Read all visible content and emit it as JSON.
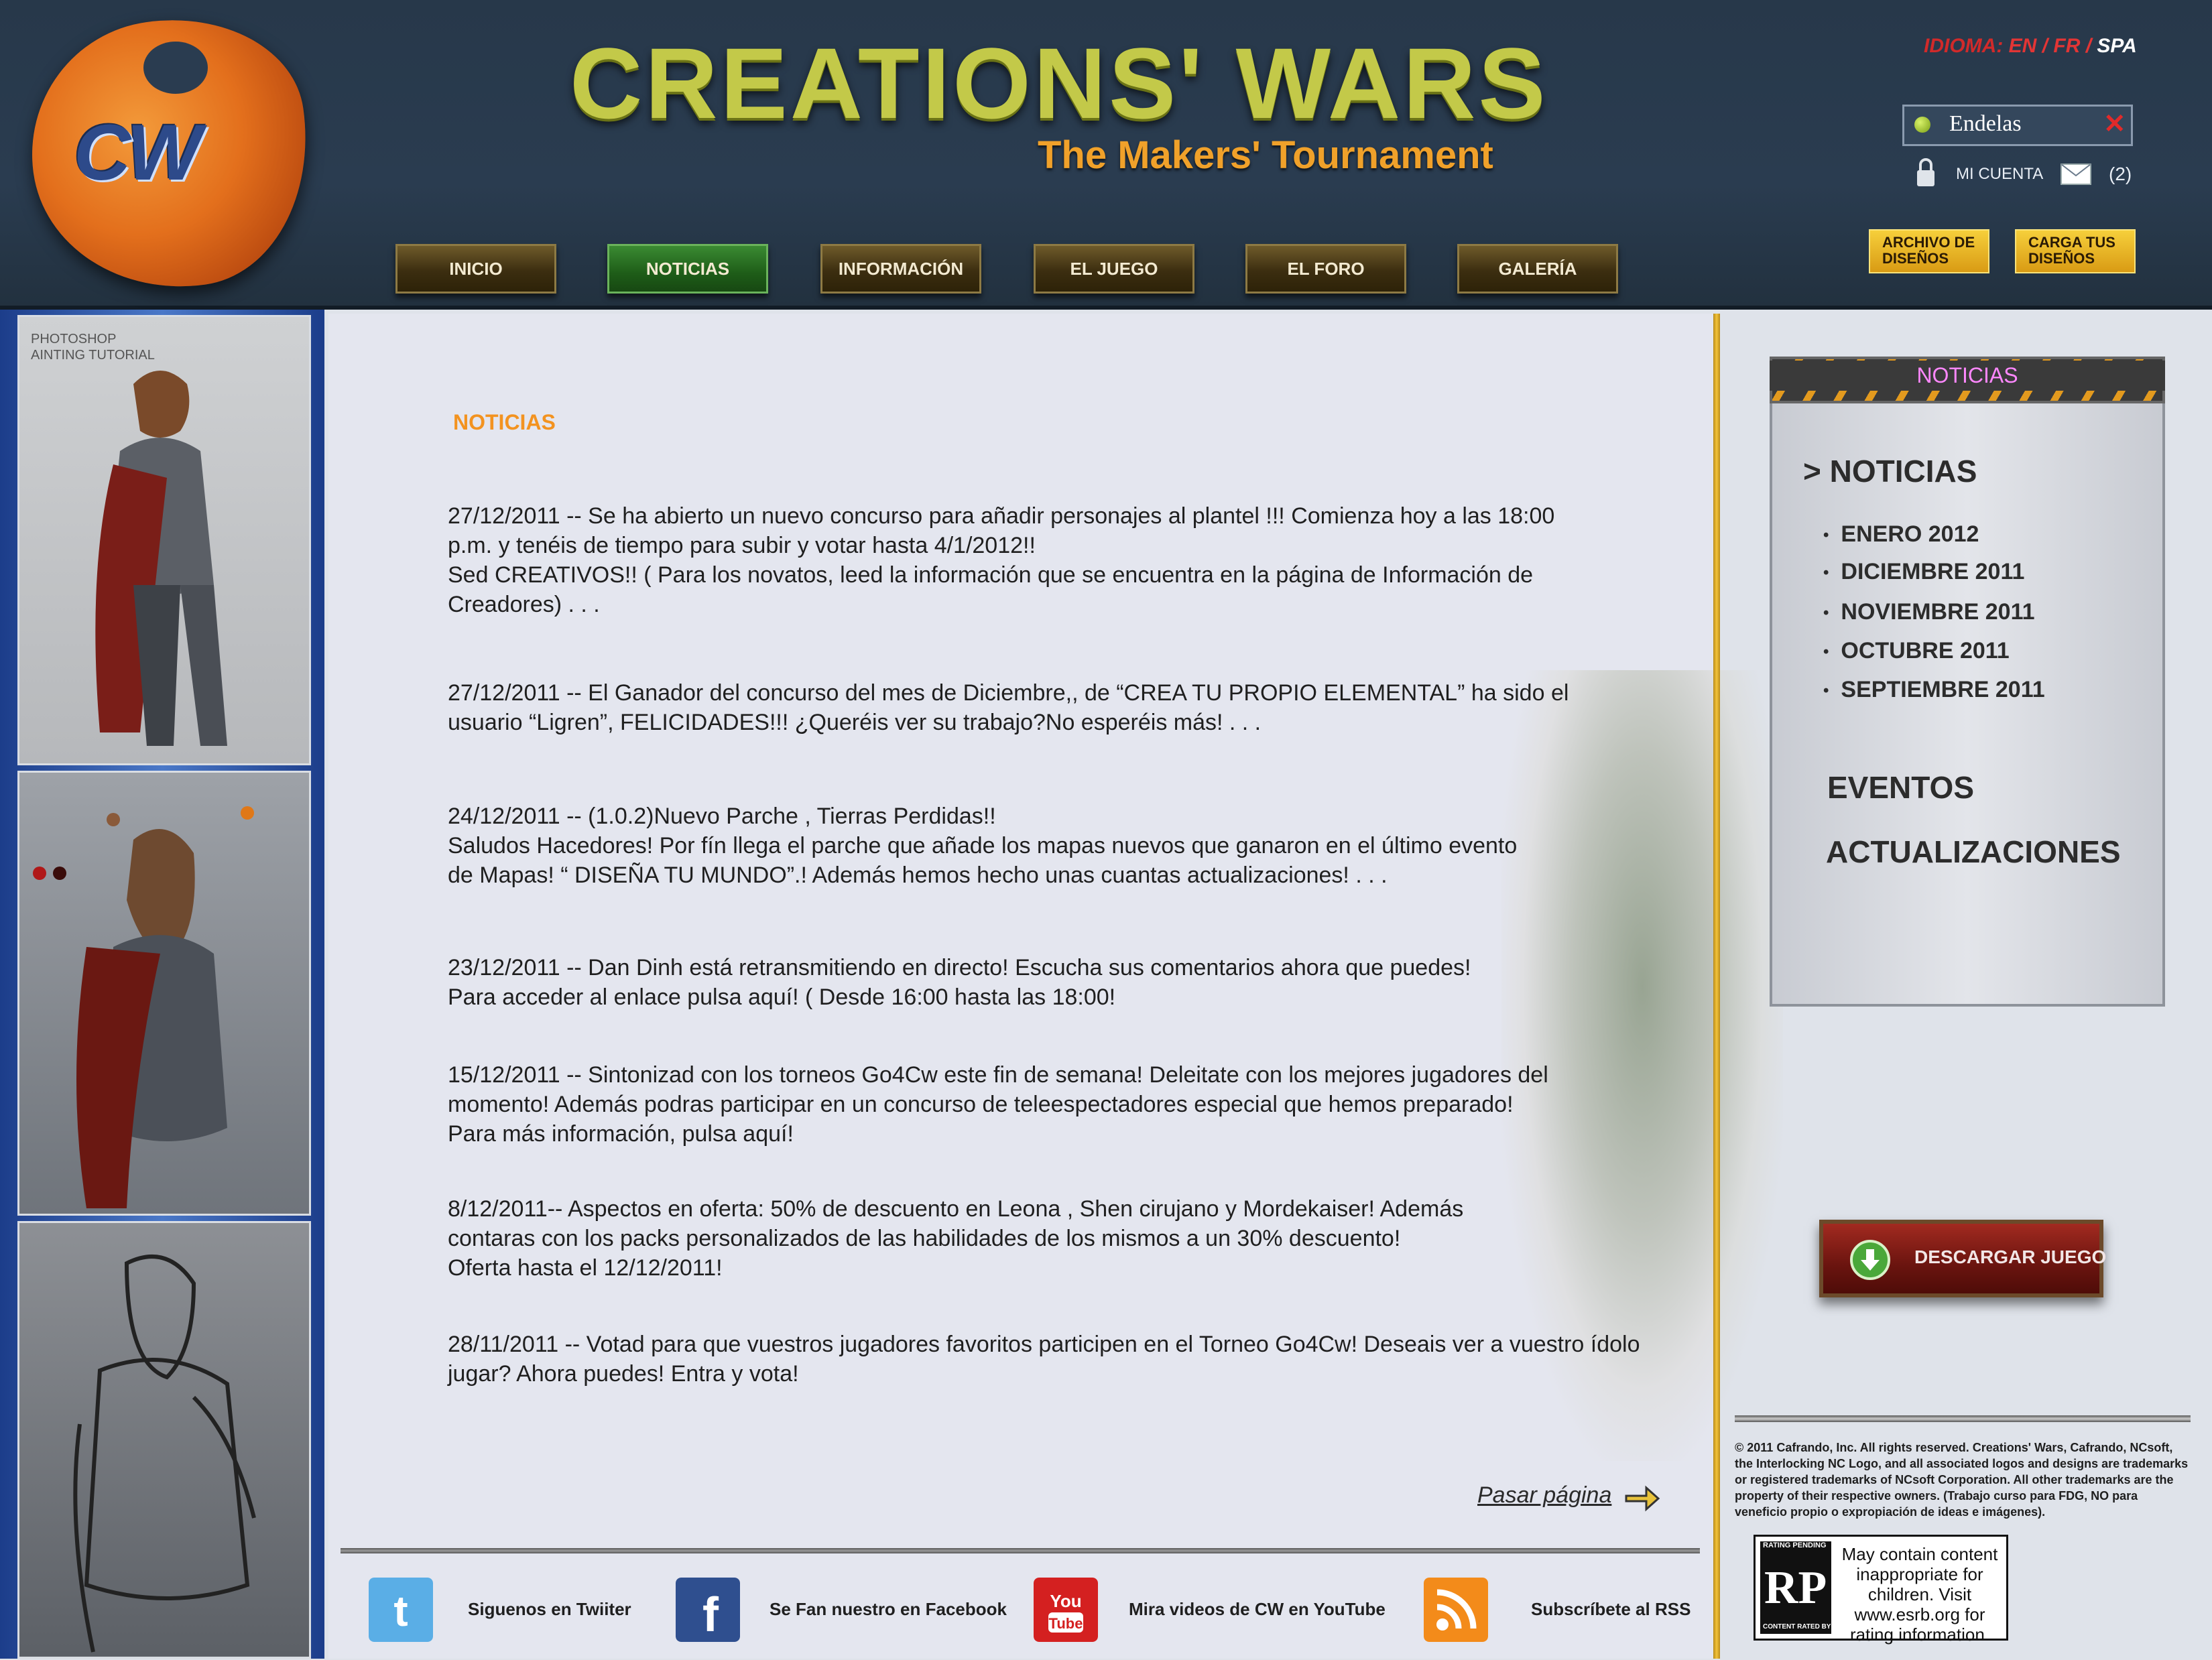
{
  "header": {
    "logo_text": "CW",
    "title": "CREATIONS' WARS",
    "subtitle": "The Makers' Tournament",
    "language": {
      "label": "IDIOMA:",
      "options": [
        "EN /",
        "FR /",
        "SPA"
      ],
      "selected": "SPA"
    },
    "user": {
      "name": "Endelas",
      "close": "✕"
    },
    "account_label": "MI CUENTA",
    "messages_count": "(2)",
    "buttons": {
      "archivo": "ARCHIVO DE DISEÑOS",
      "carga": "CARGA TUS DISEÑOS"
    }
  },
  "nav": {
    "items": [
      "INICIO",
      "NOTICIAS",
      "INFORMACIÓN",
      "EL JUEGO",
      "EL FORO",
      "GALERÍA"
    ],
    "active": "NOTICIAS"
  },
  "left_art": {
    "caption": "PHOTOSHOP\nAINTING TUTORIAL"
  },
  "main": {
    "section_title": "NOTICIAS",
    "news": [
      "27/12/2011 -- Se ha abierto un nuevo concurso para añadir personajes al plantel !!! Comienza hoy a las 18:00\np.m. y  tenéis de tiempo para subir y votar hasta 4/1/2012!!\nSed  CREATIVOS!! ( Para los novatos, leed la información que se encuentra en la página de Información de\n Creadores) . . .",
      "27/12/2011 -- El Ganador del concurso del mes de Diciembre,, de  “CREA TU PROPIO ELEMENTAL” ha sido el\nusuario “Ligren”, FELICIDADES!!! ¿Queréis ver su trabajo?No esperéis más! . . .",
      "24/12/2011 -- (1.0.2)Nuevo Parche , Tierras Perdidas!!\nSaludos Hacedores! Por fín llega el parche que añade los  mapas nuevos que ganaron en el último evento\nde  Mapas! “ DISEÑA TU MUNDO”.!  Además hemos hecho unas cuantas actualizaciones! . . .",
      "23/12/2011 -- Dan Dinh está retransmitiendo en directo! Escucha sus comentarios ahora que puedes!\nPara acceder al enlace pulsa aquí! ( Desde 16:00 hasta las 18:00!",
      "15/12/2011 -- Sintonizad con los torneos Go4Cw este fin de semana! Deleitate con los mejores jugadores del\nmomento! Además podras participar en un concurso de teleespectadores especial que hemos preparado!\nPara más información, pulsa aquí!",
      "8/12/2011--  Aspectos en oferta: 50% de descuento en Leona , Shen cirujano y Mordekaiser! Además\ncontaras con los packs personalizados de las habilidades de los mismos a un 30% descuento!\nOferta hasta el 12/12/2011!",
      "28/11/2011 -- Votad para que vuestros jugadores favoritos participen en el Torneo Go4Cw! Deseais ver a vuestro ídolo\njugar? Ahora puedes! Entra y vota!"
    ],
    "next_page": "Pasar página"
  },
  "footer": {
    "social": [
      {
        "label": "Siguenos en Twiiter",
        "icon": "twitter-icon",
        "color": "#5aaee6"
      },
      {
        "label": "Se Fan nuestro en Facebook",
        "icon": "facebook-icon",
        "color": "#2f4f8f"
      },
      {
        "label": "Mira videos de CW en YouTube",
        "icon": "youtube-icon",
        "color": "#d42020"
      },
      {
        "label": "Subscríbete al RSS",
        "icon": "rss-icon",
        "color": "#f38b1a"
      }
    ]
  },
  "sidebar": {
    "panel_title": "NOTICIAS",
    "current": "> NOTICIAS",
    "archive": [
      "ENERO  2012",
      "DICIEMBRE  2011",
      "NOVIEMBRE  2011",
      "OCTUBRE  2011",
      "SEPTIEMBRE  2011"
    ],
    "eventos": "EVENTOS",
    "actualizaciones": "ACTUALIZACIONES",
    "download": "DESCARGAR JUEGO",
    "copyright": "© 2011 Cafrando, Inc. All rights reserved. Creations' Wars, Cafrando, NCsoft, the Interlocking NC Logo, and all associated logos and designs are trademarks or registered trademarks of NCsoft Corporation. All other trademarks are the property of their respective owners. (Trabajo curso para FDG, NO para veneficio propio o expropiación de ideas e imágenes).",
    "esrb": {
      "top": "RATING PENDING",
      "mark": "RP",
      "bottom": "CONTENT RATED BY ESRB",
      "text": "May contain content inappropriate for children. Visit www.esrb.org for rating information."
    }
  },
  "colors": {
    "accent": "#f39320",
    "nav_active": "#2d7a26",
    "header_bg": "#27384a"
  }
}
